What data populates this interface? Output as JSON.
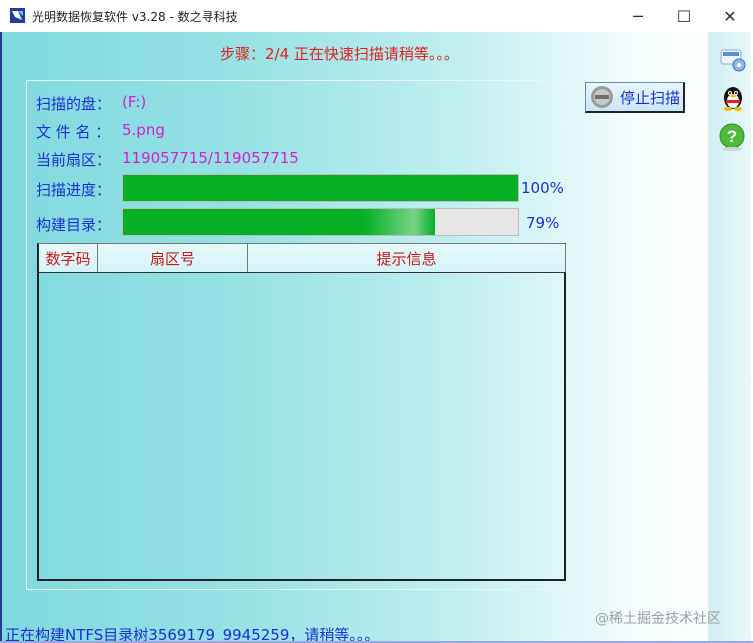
{
  "window": {
    "title": "光明数据恢复软件 v3.28 - 数之寻科技",
    "minimize_glyph": "─",
    "maximize_glyph": "☐",
    "close_glyph": "✕"
  },
  "step_text": "步骤：2/4 正在快速扫描请稍等。。。",
  "info": {
    "disk_label": "扫描的盘：",
    "disk_value": "(F:)",
    "file_label": "文 件 名 ：",
    "file_value": "5.png",
    "sector_label": "当前扇区：",
    "sector_value": "119057715/119057715"
  },
  "progress": {
    "scan_label": "扫描进度：",
    "scan_percent_text": "100%",
    "scan_value": 1.0,
    "build_label": "构建目录：",
    "build_percent_text": "79%",
    "build_value": 0.79
  },
  "table": {
    "columns": [
      "数字码",
      "扇区号",
      "提示信息"
    ],
    "rows": []
  },
  "buttons": {
    "stop_scan": "停止扫描"
  },
  "sidebar_icons": [
    "settings-icon",
    "qq-penguin-icon",
    "help-icon"
  ],
  "status_text": "正在构建NTFS目录树3569179_9945259，请稍等。。。",
  "watermark": "@稀土掘金技术社区",
  "colors": {
    "label_blue": "#1a2fd0",
    "value_magenta": "#d020d0",
    "alert_red": "#e02020",
    "progress_green": "#06b025"
  }
}
